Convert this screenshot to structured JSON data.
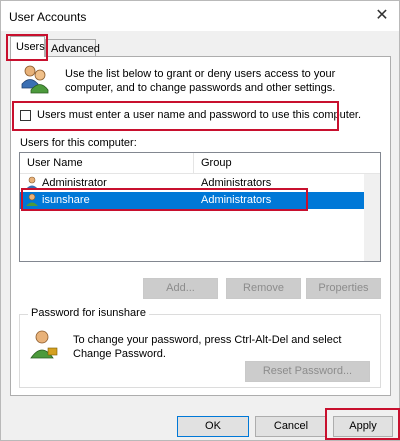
{
  "window": {
    "title": "User Accounts",
    "close_glyph": "✕"
  },
  "tabs": [
    {
      "label": "Users",
      "active": true
    },
    {
      "label": "Advanced",
      "active": false
    }
  ],
  "intro": {
    "text": "Use the list below to grant or deny users access to your computer, and to change passwords and other settings.",
    "icon": "users-icon"
  },
  "checkbox": {
    "label": "Users must enter a user name and password to use this computer.",
    "checked": false
  },
  "users_list": {
    "section_label": "Users for this computer:",
    "columns": [
      "User Name",
      "Group"
    ],
    "rows": [
      {
        "user": "Administrator",
        "group": "Administrators",
        "selected": false
      },
      {
        "user": "isunshare",
        "group": "Administrators",
        "selected": true
      }
    ]
  },
  "list_buttons": {
    "add": "Add...",
    "remove": "Remove",
    "properties": "Properties"
  },
  "password_group": {
    "title": "Password for isunshare",
    "text": "To change your password, press Ctrl-Alt-Del and select Change Password.",
    "reset_button": "Reset Password..."
  },
  "footer": {
    "ok": "OK",
    "cancel": "Cancel",
    "apply": "Apply"
  },
  "colors": {
    "highlight": "#0078d7",
    "annotation_red": "#c8102e"
  }
}
